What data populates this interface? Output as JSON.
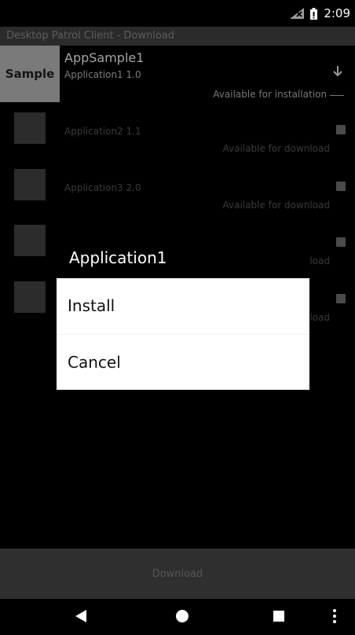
{
  "status_bar": {
    "time": "2:09",
    "icons": [
      "no-signal-icon",
      "battery-icon"
    ]
  },
  "app_title": "Desktop Patrol Client - Download",
  "apps": [
    {
      "tile_label": "Sample",
      "title": "AppSample1",
      "name": "Application1 1.0",
      "status": "Available for installation",
      "action_icon": "download-icon"
    },
    {
      "name": "Application2 1.1",
      "status": "Available for download"
    },
    {
      "name": "Application3 2.0",
      "status": "Available for download"
    },
    {
      "name": "",
      "status": "Available for download"
    },
    {
      "name": "",
      "status": "Available for download"
    }
  ],
  "dialog": {
    "title": "Application1",
    "options": [
      "Install",
      "Cancel"
    ]
  },
  "bottom_button": "Download",
  "nav_bar": [
    "back-icon",
    "home-icon",
    "recents-icon",
    "more-icon"
  ],
  "colors": {
    "dialog_bg": "#ffffff",
    "download_bar_bg": "#2f2f2f",
    "sample_tile_bg": "#7a7a7a"
  }
}
